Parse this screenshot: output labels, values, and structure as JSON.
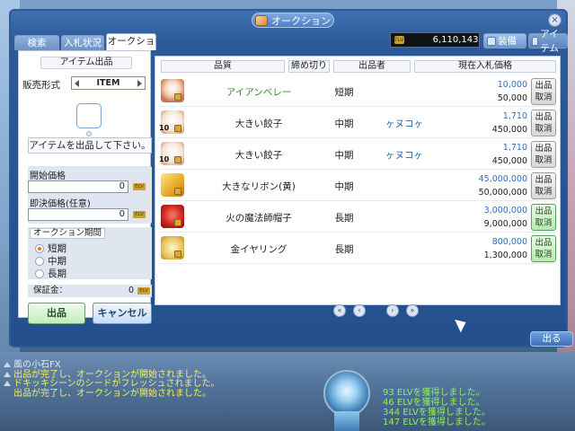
{
  "window": {
    "title": "オークション",
    "close_label": "×"
  },
  "tabs": [
    {
      "label": "検索"
    },
    {
      "label": "入札状況"
    },
    {
      "label": "オークション"
    }
  ],
  "money": {
    "currency": "ELV",
    "amount": "6,110,143"
  },
  "right_tabs": [
    {
      "label": "装備"
    },
    {
      "label": "アイテム"
    }
  ],
  "listing": {
    "section_title": "アイテム出品",
    "sale_type_label": "販売形式",
    "sale_type_value": "ITEM",
    "message": "アイテムを出品して下さい。",
    "start_price_label": "開始価格",
    "start_price_value": "0",
    "buyout_label": "即決価格(任意)",
    "buyout_value": "0",
    "currency_tag": "ELV",
    "period_title": "オークション期間",
    "periods": [
      {
        "label": "短期",
        "selected": true
      },
      {
        "label": "中期",
        "selected": false
      },
      {
        "label": "長期",
        "selected": false
      }
    ],
    "deposit_label": "保証金：",
    "deposit_value": "0",
    "submit_label": "出品",
    "cancel_label": "キャンセル"
  },
  "table": {
    "headers": [
      "品質",
      "締め切り",
      "出品者",
      "現在入札価格"
    ],
    "rows": [
      {
        "item": "アイアンベレー",
        "item_color": "#3a8a2a",
        "deadline": "短期",
        "seller": "",
        "current": "10,000",
        "current_color": "#2d6fc0",
        "buyout": "50,000",
        "button": "出品\n取消",
        "btn": "grey",
        "qty": "",
        "icon": "beret-icon"
      },
      {
        "item": "大きい餃子",
        "item_color": "#222",
        "deadline": "中期",
        "seller": "ヶヌコヶ",
        "current": "1,710",
        "current_color": "#2d6fc0",
        "buyout": "450,000",
        "button": "出品\n取消",
        "btn": "grey",
        "qty": "10",
        "icon": "dumpling-icon"
      },
      {
        "item": "大きい餃子",
        "item_color": "#222",
        "deadline": "中期",
        "seller": "ヶヌコヶ",
        "current": "1,710",
        "current_color": "#2d6fc0",
        "buyout": "450,000",
        "button": "出品\n取消",
        "btn": "grey",
        "qty": "10",
        "icon": "dumpling-icon"
      },
      {
        "item": "大きなリボン(黄)",
        "item_color": "#222",
        "deadline": "中期",
        "seller": "",
        "current": "45,000,000",
        "current_color": "#2d6fc0",
        "buyout": "50,000,000",
        "button": "出品\n取消",
        "btn": "grey",
        "qty": "",
        "icon": "ribbon-icon"
      },
      {
        "item": "火の魔法師帽子",
        "item_color": "#222",
        "deadline": "長期",
        "seller": "",
        "current": "3,000,000",
        "current_color": "#2d6fc0",
        "buyout": "9,000,000",
        "button": "出品\n取消",
        "btn": "green",
        "qty": "",
        "icon": "wizard-hat-icon"
      },
      {
        "item": "金イヤリング",
        "item_color": "#222",
        "deadline": "長期",
        "seller": "",
        "current": "800,000",
        "current_color": "#2d6fc0",
        "buyout": "1,300,000",
        "button": "出品\n取消",
        "btn": "green",
        "qty": "",
        "icon": "earring-icon"
      }
    ]
  },
  "pager": {
    "page": "1"
  },
  "exit_label": "出る",
  "chat": {
    "lines": [
      "風の小石FX",
      "出品が完了し、オークションが開始されました。",
      "ドキッキシーンのシードがフレッシュされました。",
      "出品が完了し、オークションが開始されました。"
    ],
    "gains": [
      "93 ELVを獲得しました。",
      "46 ELVを獲得しました。",
      "344 ELVを獲得しました。",
      "147 ELVを獲得しました。"
    ]
  }
}
